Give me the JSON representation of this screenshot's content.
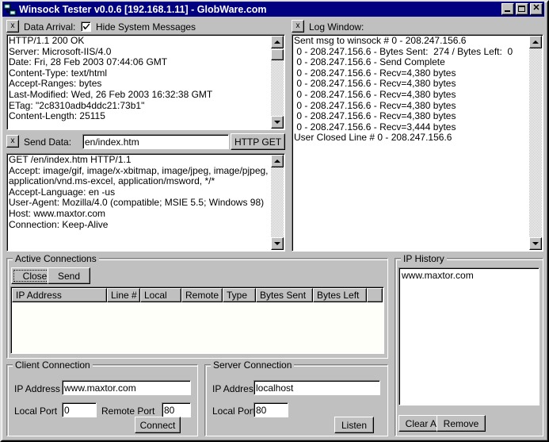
{
  "window": {
    "title": "Winsock Tester v0.0.6  [192.168.1.11] - GlobWare.com",
    "icon": "network-computers-icon",
    "minimize_label": "_",
    "maximize_label": "",
    "close_label": "✕",
    "titlebar_color": "#000080",
    "face_color": "#c0c0c0"
  },
  "data_arrival": {
    "toggle_label": "x",
    "label": "Data Arrival:",
    "hide_system_messages_label": "Hide System Messages",
    "hide_system_messages_checked": true,
    "text": "HTTP/1.1 200 OK\nServer: Microsoft-IIS/4.0\nDate: Fri, 28 Feb 2003 07:44:06 GMT\nContent-Type: text/html\nAccept-Ranges: bytes\nLast-Modified: Wed, 26 Feb 2003 16:32:38 GMT\nETag: \"2c8310adb4ddc21:73b1\"\nContent-Length: 25115"
  },
  "log_window": {
    "toggle_label": "x",
    "label": "Log Window:",
    "text": "Sent msg to winsock # 0 - 208.247.156.6\n 0 - 208.247.156.6 - Bytes Sent:  274 / Bytes Left:  0\n 0 - 208.247.156.6 - Send Complete\n 0 - 208.247.156.6 - Recv=4,380 bytes\n 0 - 208.247.156.6 - Recv=4,380 bytes\n 0 - 208.247.156.6 - Recv=4,380 bytes\n 0 - 208.247.156.6 - Recv=4,380 bytes\n 0 - 208.247.156.6 - Recv=4,380 bytes\n 0 - 208.247.156.6 - Recv=3,444 bytes\nUser Closed Line # 0 - 208.247.156.6"
  },
  "send_data": {
    "toggle_label": "x",
    "label": "Send Data:",
    "value": "en/index.htm",
    "http_get_label": "HTTP GET",
    "request_text": "GET /en/index.htm HTTP/1.1\nAccept: image/gif, image/x-xbitmap, image/jpeg, image/pjpeg,\napplication/vnd.ms-excel, application/msword, */*\nAccept-Language: en -us\nUser-Agent: Mozilla/4.0 (compatible; MSIE 5.5; Windows 98)\nHost: www.maxtor.com\nConnection: Keep-Alive"
  },
  "active_connections": {
    "title": "Active Connections",
    "close_label": "Close",
    "send_label": "Send",
    "columns": [
      "IP Address",
      "Line #",
      "Local",
      "Remote",
      "Type",
      "Bytes Sent",
      "Bytes Left",
      ""
    ],
    "rows": []
  },
  "ip_history": {
    "title": "IP History",
    "items": [
      "www.maxtor.com"
    ],
    "clear_all_label": "Clear All",
    "remove_label": "Remove"
  },
  "client_connection": {
    "title": "Client Connection",
    "ip_address_label": "IP Address",
    "ip_address_value": "www.maxtor.com",
    "local_port_label": "Local Port",
    "local_port_value": "0",
    "remote_port_label": "Remote Port",
    "remote_port_value": "80",
    "connect_label": "Connect"
  },
  "server_connection": {
    "title": "Server Connection",
    "ip_address_label": "IP Address",
    "ip_address_value": "localhost",
    "local_port_label": "Local Port",
    "local_port_value": "80",
    "listen_label": "Listen"
  }
}
